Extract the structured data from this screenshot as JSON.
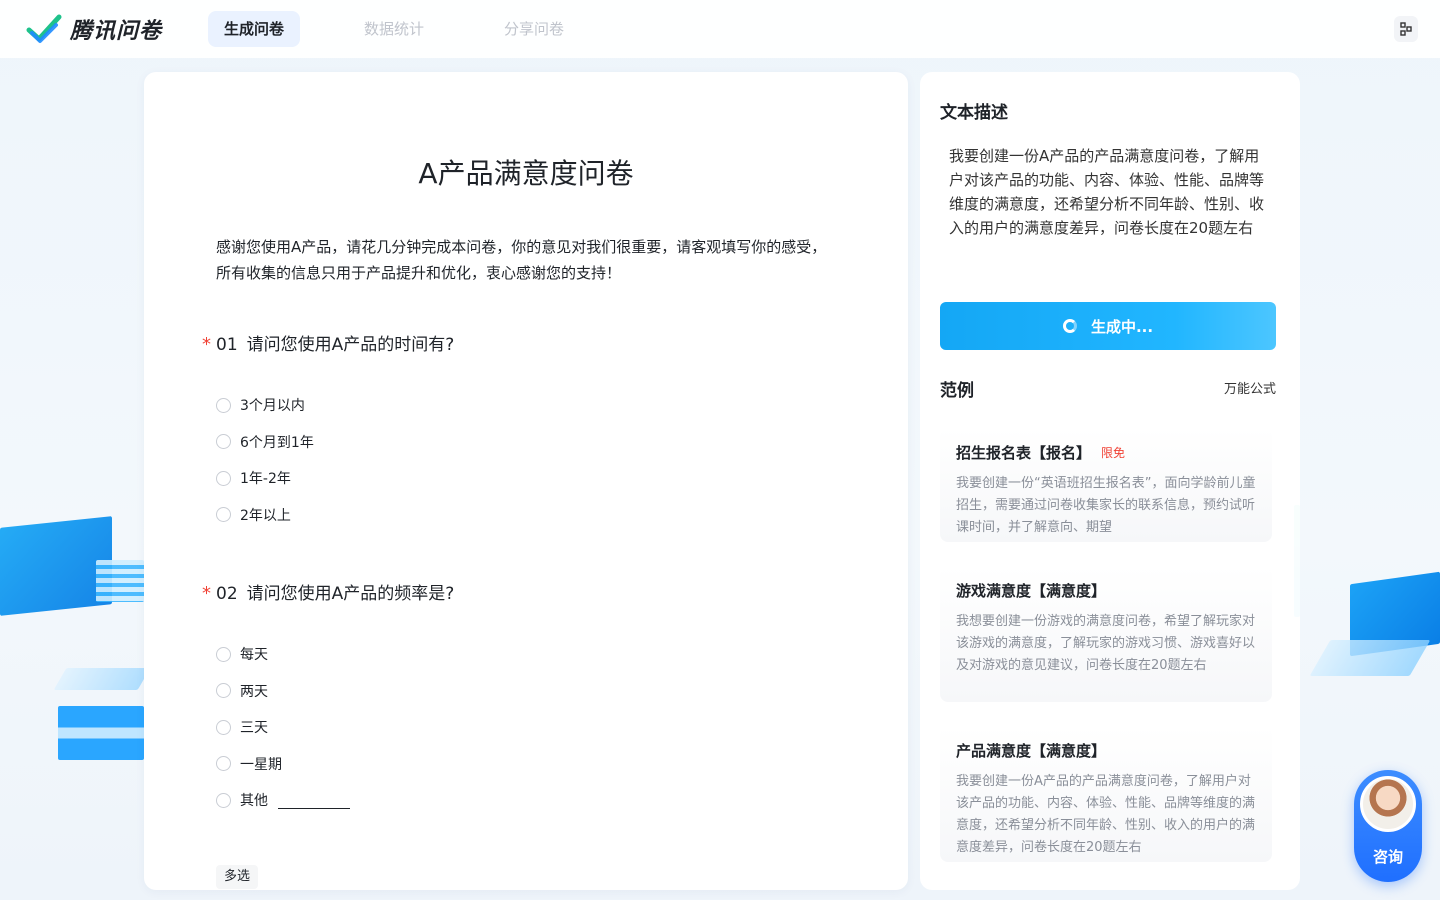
{
  "app": {
    "name": "腾讯问卷"
  },
  "nav": {
    "tabs": [
      {
        "label": "生成问卷",
        "active": true
      },
      {
        "label": "数据统计",
        "active": false
      },
      {
        "label": "分享问卷",
        "active": false
      }
    ]
  },
  "survey": {
    "title": "A产品满意度问卷",
    "intro": "感谢您使用A产品，请花几分钟完成本问卷，你的意见对我们很重要，请客观填写你的感受，所有收集的信息只用于产品提升和优化，衷心感谢您的支持！",
    "questions": [
      {
        "required_mark": "*",
        "number": "01",
        "text": "请问您使用A产品的时间有?",
        "options": [
          "3个月以内",
          "6个月到1年",
          "1年-2年",
          "2年以上"
        ]
      },
      {
        "required_mark": "*",
        "number": "02",
        "text": "请问您使用A产品的频率是?",
        "options": [
          "每天",
          "两天",
          "三天",
          "一星期",
          "其他"
        ]
      }
    ],
    "next_tag": "多选"
  },
  "panel": {
    "desc_heading": "文本描述",
    "desc_text": "我要创建一份A产品的产品满意度问卷，了解用户对该产品的功能、内容、体验、性能、品牌等维度的满意度，还希望分析不同年龄、性别、收入的用户的满意度差异，问卷长度在20题左右",
    "generate_label": "生成中...",
    "examples_heading": "范例",
    "formula_link": "万能公式",
    "examples": [
      {
        "title": "招生报名表【报名】",
        "badge": "限免",
        "text": "我要创建一份“英语班招生报名表”，面向学龄前儿童招生，需要通过问卷收集家长的联系信息，预约试听课时间，并了解意向、期望"
      },
      {
        "title": "游戏满意度【满意度】",
        "badge": "",
        "text": "我想要创建一份游戏的满意度问卷，希望了解玩家对该游戏的满意度，了解玩家的游戏习惯、游戏喜好以及对游戏的意见建议，问卷长度在20题左右"
      },
      {
        "title": "产品满意度【满意度】",
        "badge": "",
        "text": "我要创建一份A产品的产品满意度问卷，了解用户对该产品的功能、内容、体验、性能、品牌等维度的满意度，还希望分析不同年龄、性别、收入的用户的满意度差异，问卷长度在20题左右"
      }
    ]
  },
  "consult": {
    "label": "咨询"
  },
  "colors": {
    "accent": "#1aa7f5",
    "required": "#f04134",
    "brand_check": "#1ec28b"
  },
  "icons": {
    "logo": "check-logo-icon",
    "spinner": "loading-spinner-icon",
    "top_right": "qr-code-icon"
  }
}
